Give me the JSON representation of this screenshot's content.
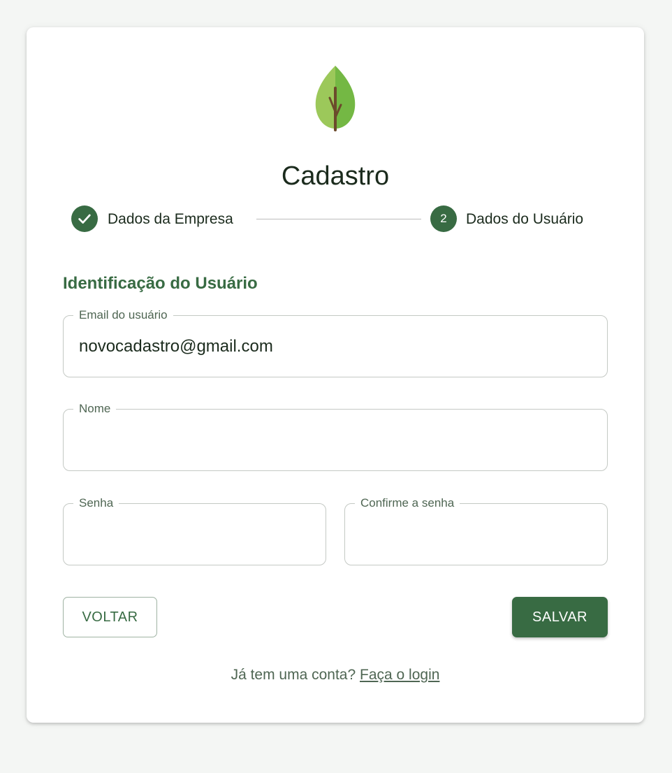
{
  "page": {
    "title": "Cadastro",
    "logo_icon": "leaf-icon",
    "colors": {
      "primary": "#386b43",
      "leaf_light": "#9cc85a",
      "leaf_dark": "#74b844",
      "stem": "#6b4a2b"
    }
  },
  "stepper": {
    "steps": [
      {
        "label": "Dados da Empresa",
        "status": "completed",
        "icon": "check-icon"
      },
      {
        "label": "Dados do Usuário",
        "number": "2",
        "status": "active"
      }
    ]
  },
  "form": {
    "section_title": "Identificação do Usuário",
    "email": {
      "label": "Email do usuário",
      "value": "novocadastro@gmail.com"
    },
    "name": {
      "label": "Nome",
      "value": ""
    },
    "password": {
      "label": "Senha",
      "value": ""
    },
    "confirm_password": {
      "label": "Confirme a senha",
      "value": ""
    }
  },
  "actions": {
    "back_label": "VOLTAR",
    "save_label": "SALVAR"
  },
  "footer": {
    "prompt": "Já tem uma conta?",
    "link_label": "Faça o login"
  }
}
